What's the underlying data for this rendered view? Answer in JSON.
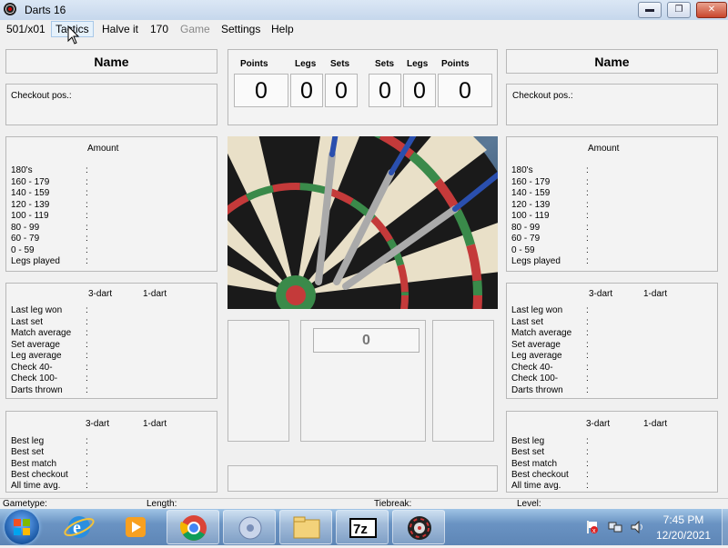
{
  "window": {
    "title": "Darts 16"
  },
  "menu": [
    "501/x01",
    "Tactics",
    "Halve it",
    "170",
    "Game",
    "Settings",
    "Help"
  ],
  "player_left": {
    "name_label": "Name",
    "checkout_label": "Checkout pos.:",
    "amount_header": "Amount",
    "amount_rows": [
      "180's",
      "160 - 179",
      "140 - 159",
      "120 - 139",
      "100 - 119",
      "80 - 99",
      "60 - 79",
      "0 - 59",
      "Legs played"
    ],
    "stats_header_3dart": "3-dart",
    "stats_header_1dart": "1-dart",
    "stats_rows": [
      "Last leg won",
      "Last set",
      "Match average",
      "Set average",
      "Leg average",
      "Check 40-",
      "Check 100-",
      "Darts thrown"
    ],
    "best_header_3dart": "3-dart",
    "best_header_1dart": "1-dart",
    "best_rows": [
      "Best leg",
      "Best set",
      "Best match",
      "Best checkout",
      "All time avg."
    ]
  },
  "player_right": {
    "name_label": "Name",
    "checkout_label": "Checkout pos.:",
    "amount_header": "Amount",
    "amount_rows": [
      "180's",
      "160 - 179",
      "140 - 159",
      "120 - 139",
      "100 - 119",
      "80 - 99",
      "60 - 79",
      "0 - 59",
      "Legs played"
    ],
    "stats_header_3dart": "3-dart",
    "stats_header_1dart": "1-dart",
    "stats_rows": [
      "Last leg won",
      "Last set",
      "Match average",
      "Set average",
      "Leg average",
      "Check 40-",
      "Check 100-",
      "Darts thrown"
    ],
    "best_header_3dart": "3-dart",
    "best_header_1dart": "1-dart",
    "best_rows": [
      "Best leg",
      "Best set",
      "Best match",
      "Best checkout",
      "All time avg."
    ]
  },
  "colon": ":",
  "scoreboard": {
    "headers": [
      "Points",
      "Legs",
      "Sets",
      "Sets",
      "Legs",
      "Points"
    ],
    "values": [
      "0",
      "0",
      "0",
      "0",
      "0",
      "0"
    ]
  },
  "center_score": "0",
  "statusbar": {
    "gametype": "Gametype:",
    "length": "Length:",
    "tiebreak": "Tiebreak:",
    "level": "Level:"
  },
  "taskbar": {
    "buttons": [
      "start-orb-icon",
      "internet-explorer-icon",
      "media-player-icon",
      "chrome-icon",
      "media-center-icon",
      "file-explorer-icon",
      "seven-zip-icon",
      "darts-app-icon"
    ],
    "clock_time": "7:45 PM",
    "clock_date": "12/20/2021"
  }
}
